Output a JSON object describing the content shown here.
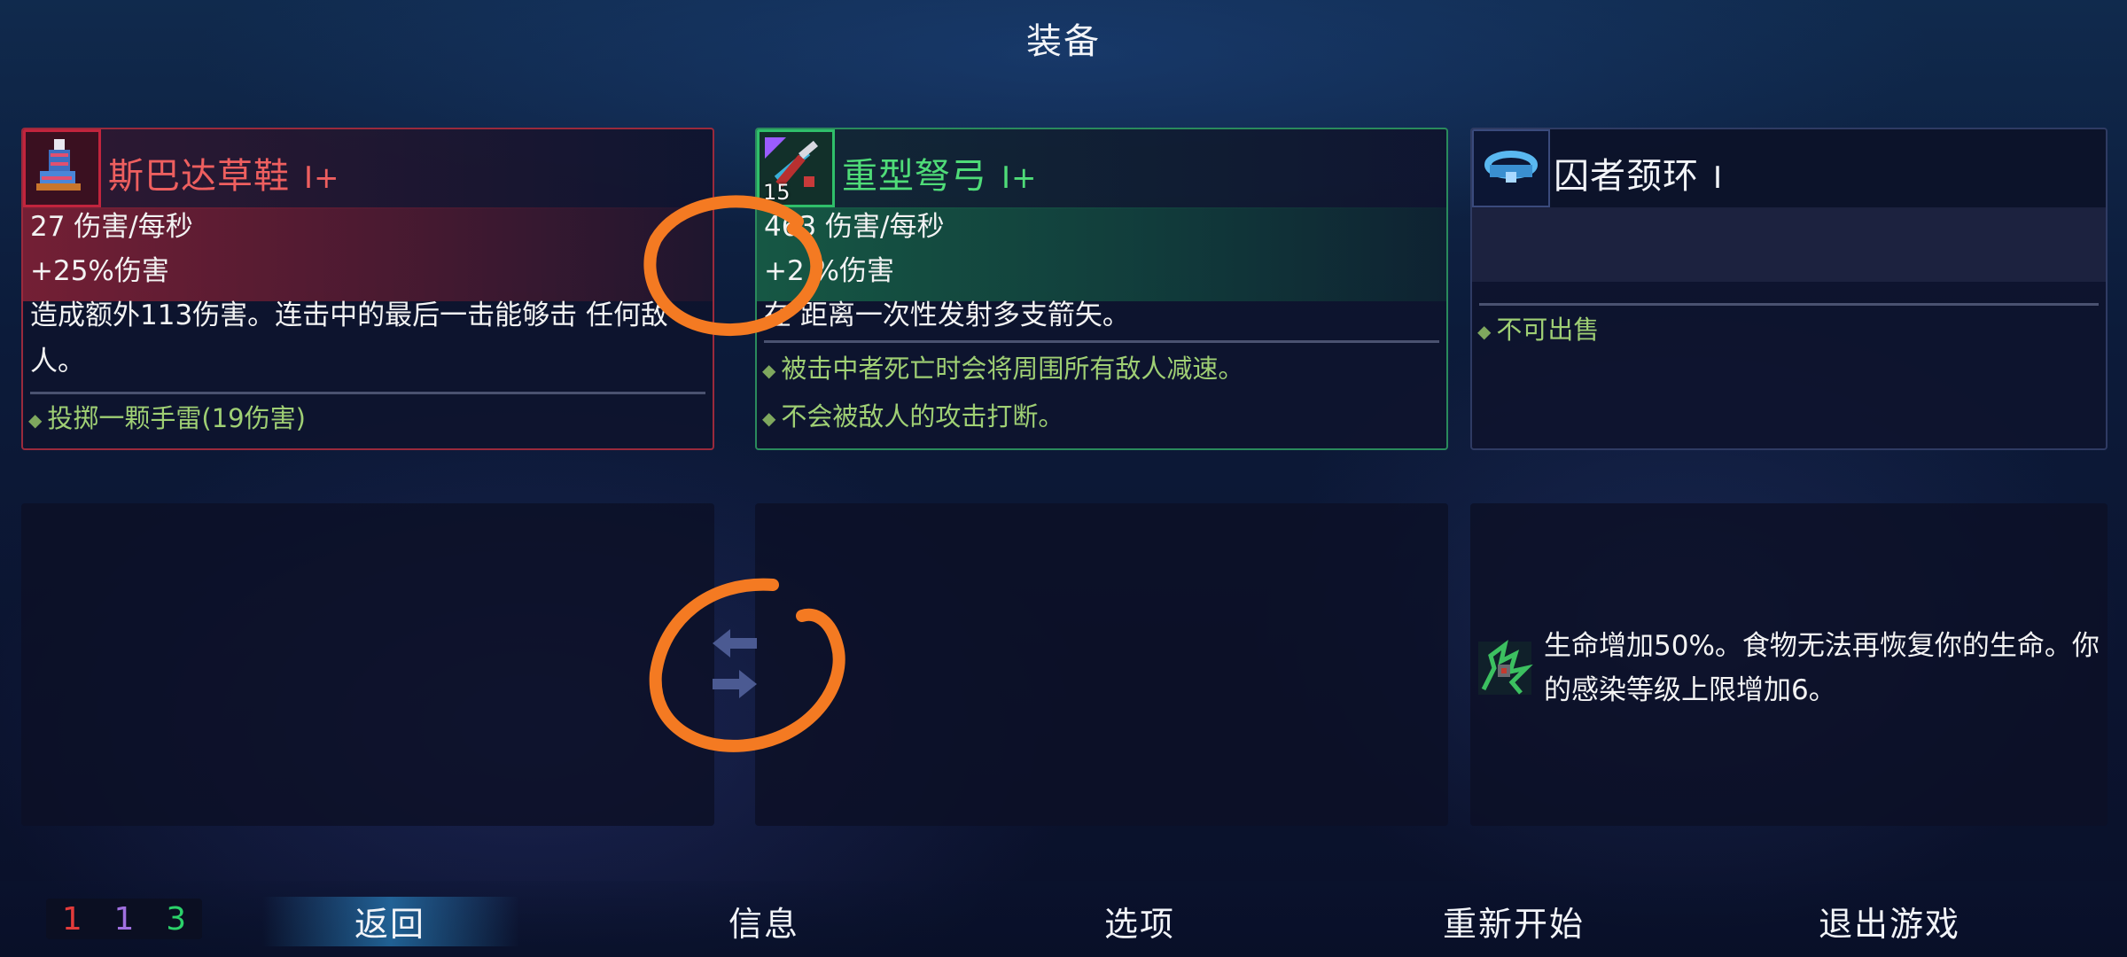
{
  "header": {
    "title": "装备"
  },
  "equipment": [
    {
      "name": "斯巴达草鞋",
      "tier": "I+",
      "rarity_color": "#c2243d",
      "icon": "sandal-icon",
      "level": "",
      "stats": [
        "27 伤害/每秒",
        "+25%伤害"
      ],
      "description": "造成额外113伤害。连击中的最后一击能够击 任何敌人。",
      "bullets": [
        "投掷一颗手雷(19伤害)"
      ]
    },
    {
      "name": "重型弩弓",
      "tier": "I+",
      "rarity_color": "#2fbf6a",
      "icon": "crossbow-icon",
      "level": "15",
      "stats": [
        "463 伤害/每秒",
        "+2 %伤害"
      ],
      "description": "在 距离一次性发射多支箭矢。",
      "bullets": [
        "被击中者死亡时会将周围所有敌人减速。",
        "不会被敌人的攻击打断。"
      ]
    },
    {
      "name": "囚者颈环",
      "tier": "I",
      "rarity_color": "#3a4a7c",
      "icon": "collar-icon",
      "bullets": [
        "不可出售"
      ]
    }
  ],
  "mutation": {
    "icon": "mutation-vine-icon",
    "text": "生命增加50%。食物无法再恢复你的生命。你的感染等级上限增加6。"
  },
  "counters": {
    "red": "1",
    "purple": "1",
    "green": "3"
  },
  "menu": {
    "back": "返回",
    "info": "信息",
    "options": "选项",
    "restart": "重新开始",
    "quit": "退出游戏"
  },
  "colors": {
    "annotation_orange": "#f47a22",
    "highlight_blue": "#32a0e6"
  }
}
